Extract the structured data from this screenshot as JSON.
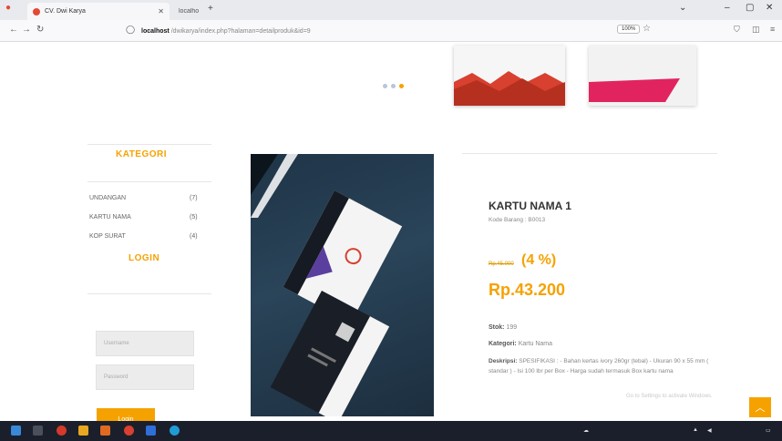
{
  "browser": {
    "tabs": [
      {
        "label": "CV. Dwi Karya",
        "active": true
      },
      {
        "label": "localhost/dwikarya/admin/index.p...",
        "active": false
      }
    ],
    "new_tab": "+",
    "url_host": "localhost",
    "url_rest": "/dwikarya/index.php?halaman=detailproduk&id=9",
    "zoom": "100%"
  },
  "sidebar": {
    "kategori_title": "KATEGORI",
    "categories": [
      {
        "name": "UNDANGAN",
        "count": "(7)"
      },
      {
        "name": "KARTU NAMA",
        "count": "(5)"
      },
      {
        "name": "KOP SURAT",
        "count": "(4)"
      }
    ],
    "login_title": "LOGIN",
    "username_placeholder": "Username",
    "password_placeholder": "Password",
    "login_button": "Login"
  },
  "product": {
    "title": "KARTU NAMA 1",
    "code": "Kode Barang : B0013",
    "old_price": "Rp.45.000",
    "discount": "(4 %)",
    "price": "Rp.43.200",
    "stock_label": "Stok:",
    "stock_value": "199",
    "category_label": "Kategori:",
    "category_value": "Kartu Nama",
    "desc_label": "Deskripsi:",
    "desc_value": "SPESIFIKASI : - Bahan kertas ivory 260gr (tebal) - Ukuran 90 x 55 mm ( standar ) - Isi 100 lbr per Box - Harga sudah termasuk Box kartu nama"
  },
  "watermark": "Go to Settings to activate Windows.",
  "colors": {
    "accent": "#f5a200",
    "taskbar": "#1b1f2b"
  },
  "icons": {
    "scroll_top": "chevron-up-icon"
  }
}
